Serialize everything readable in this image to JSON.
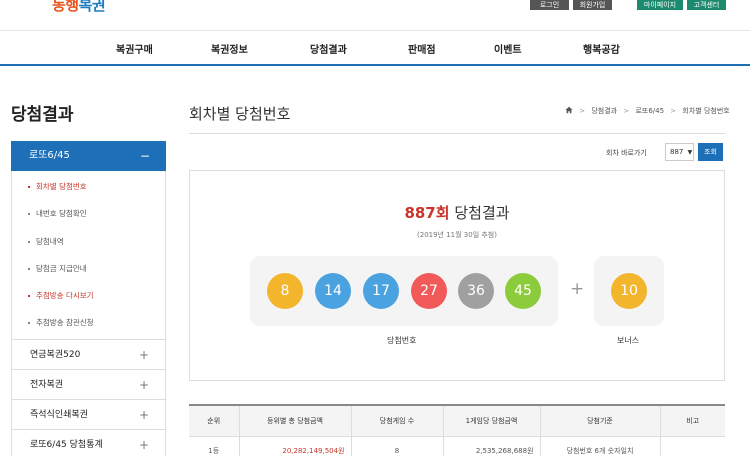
{
  "header": {
    "logo": {
      "part1": "동행",
      "part2": "복권"
    },
    "top_buttons": [
      "로그인",
      "회원가입",
      "마이페이지",
      "고객센터"
    ],
    "nav": [
      "복권구매",
      "복권정보",
      "당첨결과",
      "판매점",
      "이벤트",
      "행복공감"
    ]
  },
  "sidebar": {
    "title": "당첨결과",
    "main": {
      "label": "로또6/45",
      "toggle": "−"
    },
    "subs": [
      "회차별 당첨번호",
      "내번호 당첨확인",
      "당첨내역",
      "당첨금 지급안내",
      "추첨방송 다시보기",
      "추첨방송 참관신청"
    ],
    "categories": [
      "연금복권520",
      "전자복권",
      "즉석식인쇄복권",
      "로또6/45 당첨통계"
    ],
    "plus": "+"
  },
  "content": {
    "title": "회차별 당첨번호",
    "breadcrumb": [
      "당첨결과",
      "로또6/45",
      "회차별 당첨번호"
    ],
    "goto_label": "회차 바로가기",
    "goto_value": "887",
    "goto_button": "조회",
    "draw": {
      "number": "887회",
      "result_text": "당첨결과",
      "date": "(2019년 11월 30일 추첨)",
      "balls": [
        8,
        14,
        17,
        27,
        36,
        45
      ],
      "ball_colors": [
        "#f3b52c",
        "#4aa3e0",
        "#4aa3e0",
        "#f25a5a",
        "#a0a0a0",
        "#8ccb3b"
      ],
      "plus": "+",
      "bonus": 10,
      "bonus_color": "#f3b52c",
      "win_label": "당첨번호",
      "bonus_label": "보너스"
    },
    "table": {
      "headers": [
        "순위",
        "등위별 총 당첨금액",
        "당첨게임 수",
        "1게임당 당첨금액",
        "당첨기준",
        "비고"
      ],
      "rows": [
        [
          "1등",
          "20,282,149,504원",
          "8",
          "2,535,268,688원",
          "당첨번호 6개 숫자일치",
          ""
        ]
      ]
    }
  }
}
